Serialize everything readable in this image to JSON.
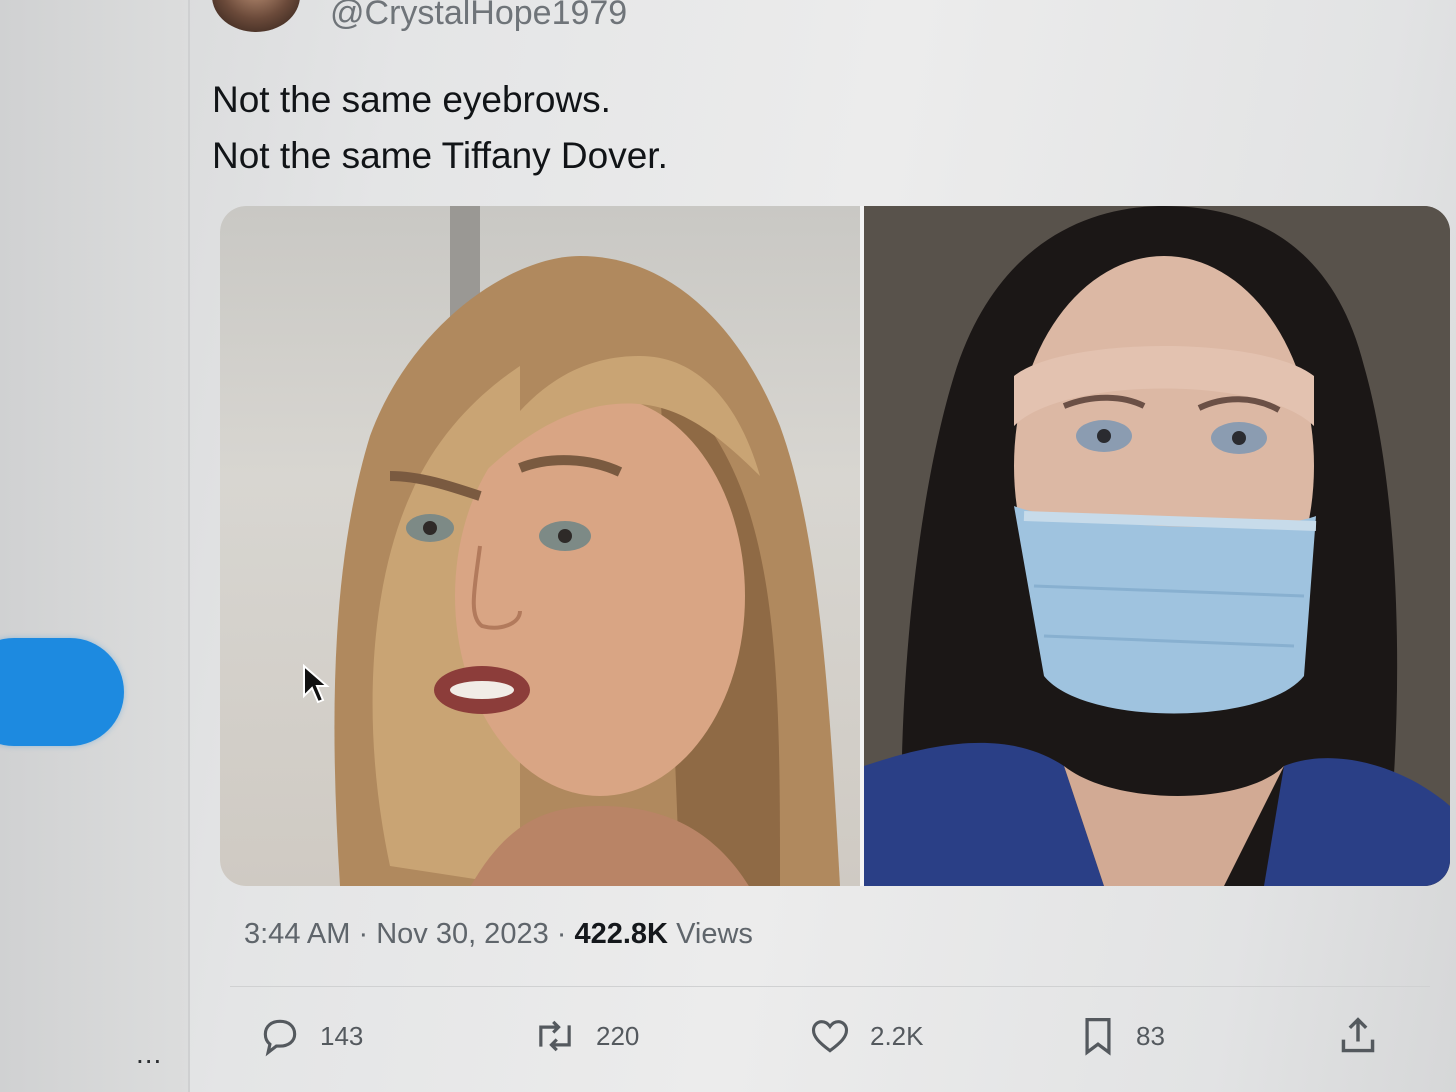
{
  "author": {
    "handle": "@CrystalHope1979"
  },
  "tweet": {
    "lines": [
      "Not the same eyebrows.",
      "Not the same Tiffany Dover."
    ]
  },
  "meta": {
    "time": "3:44 AM",
    "date": "Nov 30, 2023",
    "views_count": "422.8K",
    "views_label": "Views"
  },
  "actions": {
    "replies": "143",
    "reposts": "220",
    "likes": "2.2K",
    "bookmarks": "83"
  },
  "sidebar": {
    "more_label": "..."
  },
  "icons": {
    "reply": "reply-icon",
    "repost": "repost-icon",
    "like": "heart-icon",
    "bookmark": "bookmark-icon",
    "share": "share-icon"
  },
  "colors": {
    "accent": "#1d8ae0",
    "text": "#111417",
    "muted": "#5f656b"
  }
}
